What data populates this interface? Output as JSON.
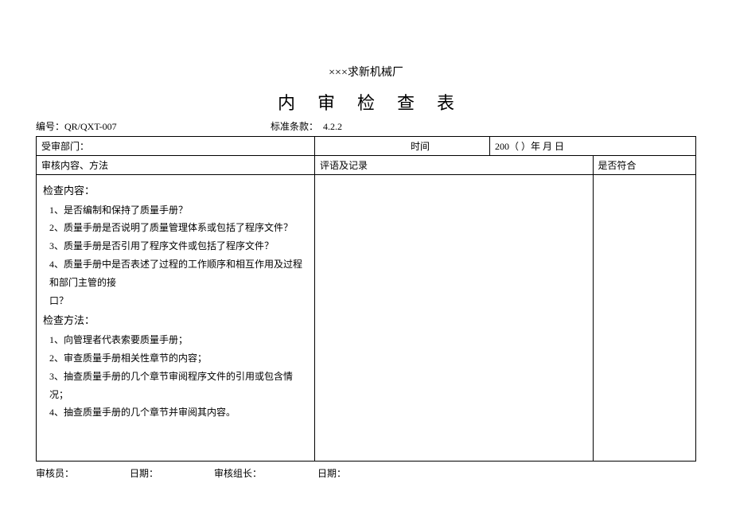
{
  "company": "×××求新机械厂",
  "title": "内审检查表",
  "meta": {
    "code_label": "编号：",
    "code_value": "QR/QXT-007",
    "std_label": "标准条款：",
    "std_value": "4.2.2"
  },
  "header_row": {
    "dept": "受审部门：",
    "time_label": "时间",
    "time_value": "200（    ）年   月   日"
  },
  "columns": {
    "left": "审核内容、方法",
    "mid": "评语及记录",
    "right": "是否符合"
  },
  "content": {
    "check_content_head": "检查内容：",
    "cc1": "1、是否编制和保持了质量手册？",
    "cc2": "2、质量手册是否说明了质量管理体系或包括了程序文件？",
    "cc3": "3、质量手册是否引用了程序文件或包括了程序文件？",
    "cc4": "4、质量手册中是否表述了过程的工作顺序和相互作用及过程和部门主管的接",
    "cc5": "口？",
    "check_method_head": "检查方法：",
    "cm1": "1、向管理者代表索要质量手册；",
    "cm2": "2、审查质量手册相关性章节的内容；",
    "cm3": "3、抽查质量手册的几个章节审阅程序文件的引用或包含情况；",
    "cm4": "4、抽查质量手册的几个章节并审阅其内容。"
  },
  "footer": {
    "auditor": "审核员：",
    "date1": "日期：",
    "leader": "审核组长：",
    "date2": "日期："
  }
}
